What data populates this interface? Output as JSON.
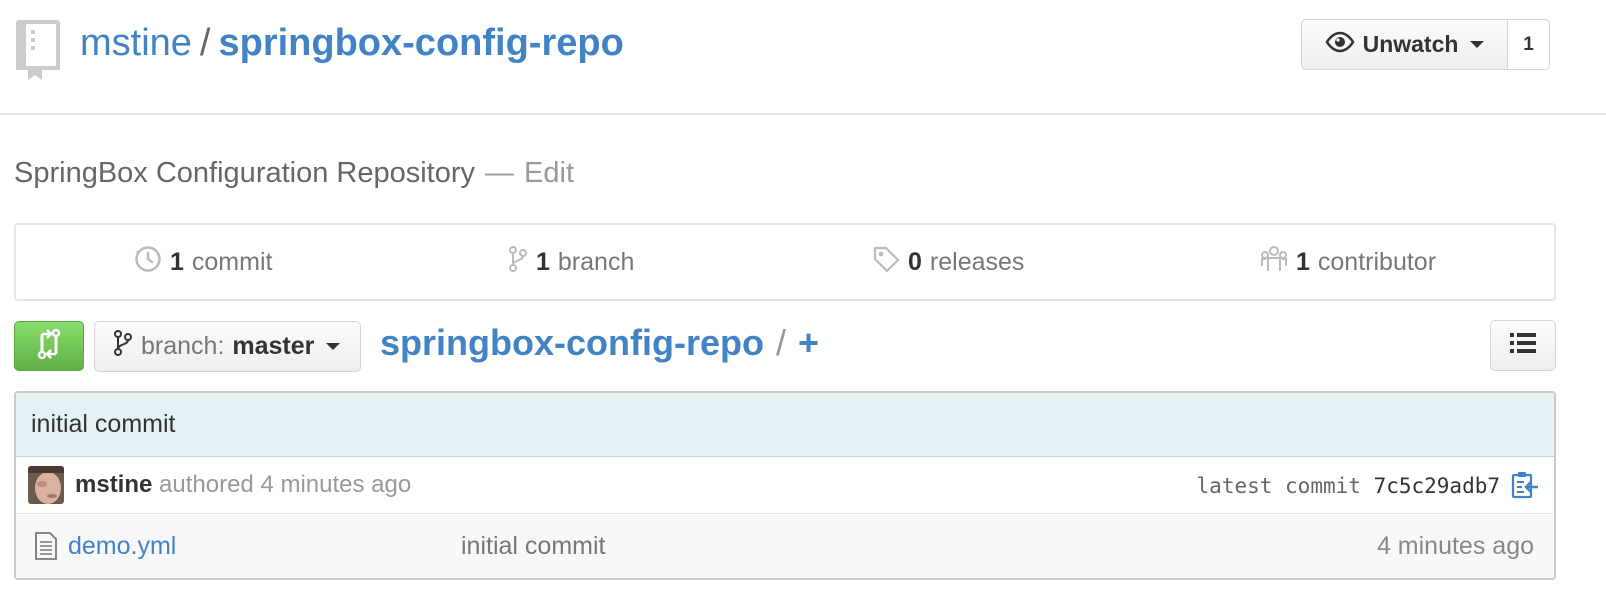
{
  "header": {
    "owner": "mstine",
    "separator": "/",
    "repo_name": "springbox-config-repo",
    "unwatch_label": "Unwatch",
    "watch_count": "1"
  },
  "description": {
    "text": "SpringBox Configuration Repository",
    "dash": "—",
    "edit_label": "Edit"
  },
  "stats": {
    "commits": {
      "count": "1",
      "label": "commit"
    },
    "branches": {
      "count": "1",
      "label": "branch"
    },
    "releases": {
      "count": "0",
      "label": "releases"
    },
    "contributors": {
      "count": "1",
      "label": "contributor"
    }
  },
  "file_nav": {
    "branch_prefix": "branch:",
    "branch_name": "master",
    "breadcrumb_repo": "springbox-config-repo",
    "breadcrumb_sep": "/",
    "add_label": "+"
  },
  "commit": {
    "message": "initial commit",
    "author": "mstine",
    "authored_text": "authored 4 minutes ago",
    "latest_label": "latest commit",
    "sha": "7c5c29adb7"
  },
  "files": [
    {
      "name": "demo.yml",
      "message": "initial commit",
      "age": "4 minutes ago"
    }
  ],
  "colors": {
    "link": "#4183c4",
    "compare_green": "#60b044",
    "commit_bar_bg": "#e6f1f6"
  },
  "icons": {
    "repo": "repo-icon",
    "eye": "eye-icon",
    "history": "history-icon",
    "branch": "git-branch-icon",
    "tag": "tag-icon",
    "contributors": "organization-icon",
    "compare": "git-compare-icon",
    "list": "list-icon",
    "copy": "clippy-icon",
    "file": "file-text-icon"
  }
}
